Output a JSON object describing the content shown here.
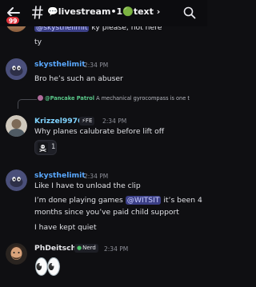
{
  "header": {
    "unread_count": "99",
    "channel_name": "💬livestream•1🟢text ›"
  },
  "messages": [
    {
      "text_before": "@skysthelimit",
      "text_after": " ky please, not here",
      "line2": "ty"
    },
    {
      "username": "skysthelimit",
      "timestamp": "2:34 PM",
      "text": "Bro he’s such an abuser"
    },
    {
      "reply_author": "@Pancake Patrol",
      "reply_text": " A mechanical gyrocompass is one that track your leveled heading (manually set no north for",
      "username": "Krizzel9976",
      "role": "⚡FE",
      "timestamp": "2:34 PM",
      "text": "Why planes calubrate before lift off",
      "reaction_count": "1"
    },
    {
      "username": "skysthelimit",
      "timestamp": "2:34 PM",
      "line1": "Like I have to unload the clip",
      "line2_before": "I’m done playing games ",
      "line2_mention": "@WITSIT",
      "line2_after": " it’s been 4",
      "line3": "months since you’ve paid child support",
      "line4": "I have kept quiet"
    },
    {
      "username": "PhDeitsch",
      "role": "Nerd",
      "timestamp": "2:34 PM",
      "text": "👀"
    }
  ],
  "colors": {
    "skysthelimit": "#5aa9ff",
    "krizzel": "#7fd3ff",
    "phdeitsch": "#e6e6ea",
    "mention_bg": "#3b3f86",
    "reply_author": "#5ac98a"
  }
}
